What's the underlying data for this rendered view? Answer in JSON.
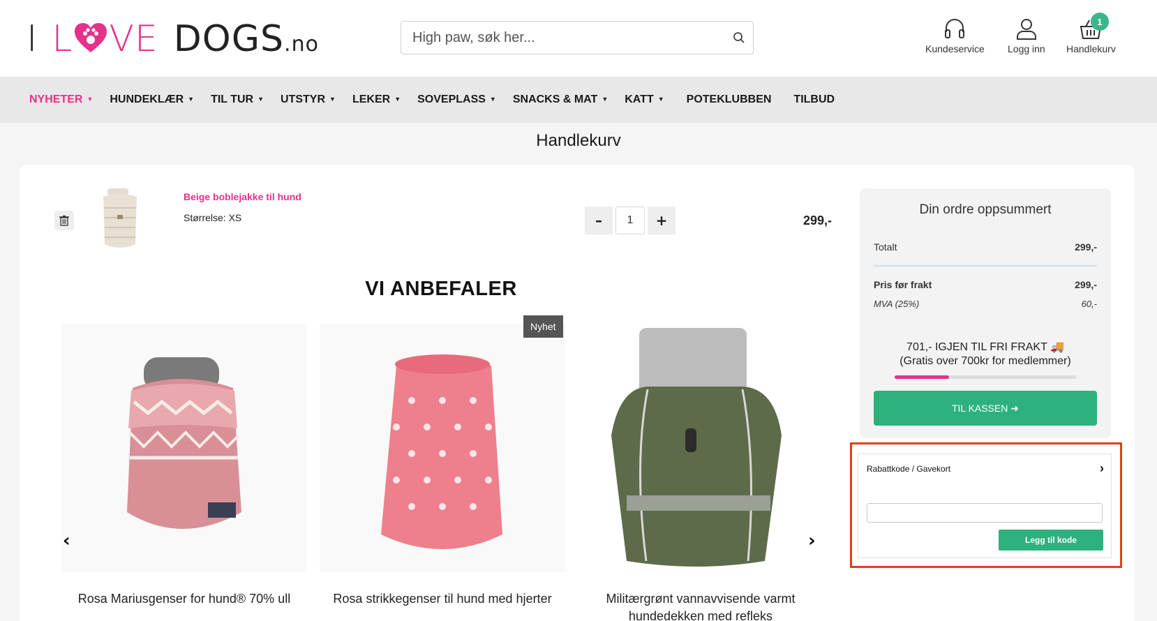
{
  "logo": {
    "part1": "I",
    "part2a": "L",
    "part2b": "VE",
    "part3": "DOGS",
    "part4": ".no"
  },
  "search": {
    "placeholder": "High paw, søk her..."
  },
  "header_actions": {
    "customer_service": "Kundeservice",
    "login": "Logg inn",
    "cart": "Handlekurv",
    "cart_count": "1"
  },
  "nav": {
    "items": [
      {
        "label": "NYHETER",
        "dropdown": true,
        "active": true
      },
      {
        "label": "HUNDEKLÆR",
        "dropdown": true
      },
      {
        "label": "TIL TUR",
        "dropdown": true
      },
      {
        "label": "UTSTYR",
        "dropdown": true
      },
      {
        "label": "LEKER",
        "dropdown": true
      },
      {
        "label": "SOVEPLASS",
        "dropdown": true
      },
      {
        "label": "SNACKS & MAT",
        "dropdown": true
      },
      {
        "label": "KATT",
        "dropdown": true
      },
      {
        "label": "POTEKLUBBEN",
        "dropdown": false
      },
      {
        "label": "TILBUD",
        "dropdown": false
      }
    ]
  },
  "page": {
    "title": "Handlekurv"
  },
  "cart_item": {
    "name": "Beige boblejakke til hund",
    "size": "Størrelse: XS",
    "quantity": "1",
    "minus": "–",
    "plus": "+",
    "price": "299,-"
  },
  "recommendations": {
    "title": "VI ANBEFALER",
    "badge": "Nyhet",
    "prev": "‹",
    "next": "›",
    "products": [
      {
        "name": "Rosa Mariusgenser for hund® 70% ull"
      },
      {
        "name": "Rosa strikkegenser til hund med hjerter"
      },
      {
        "name": "Militærgrønt vannavvisende varmt hundedekken med refleks"
      }
    ]
  },
  "summary": {
    "title": "Din ordre oppsummert",
    "total_label": "Totalt",
    "total_value": "299,-",
    "pre_shipping_label": "Pris før frakt",
    "pre_shipping_value": "299,-",
    "vat_label": "MVA (25%)",
    "vat_value": "60,-",
    "freight_line1": "701,- IGJEN TIL FRI FRAKT 🚚",
    "freight_line2": "(Gratis over 700kr for medlemmer)",
    "progress_percent": 30,
    "checkout_label": "TIL KASSEN ➜"
  },
  "discount": {
    "label": "Rabattkode / Gavekort",
    "chevron": "›",
    "input_value": "",
    "button_label": "Legg til kode"
  },
  "colors": {
    "brand_pink": "#e5318a",
    "brand_green": "#2db27f",
    "badge_green": "#3db58a",
    "highlight_outline": "#e0401a"
  }
}
